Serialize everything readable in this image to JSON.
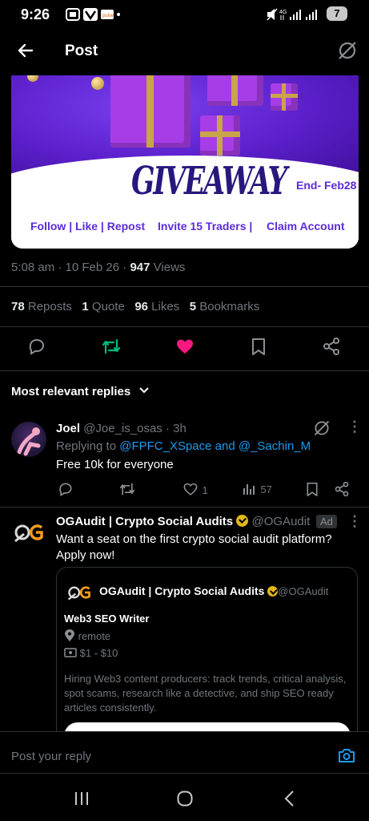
{
  "status_bar": {
    "time": "9:26",
    "network": "4G",
    "battery": "7"
  },
  "header": {
    "title": "Post"
  },
  "banner": {
    "headline": "GIVEAWAY",
    "end_text": "End- Feb28",
    "links": [
      "Follow | Like | Repost",
      "Invite 15 Traders |",
      "Claim Account"
    ],
    "colors": {
      "purple": "#5a1fc9",
      "gold": "#c9a54a",
      "text": "#27187e"
    }
  },
  "post_meta": {
    "time": "5:08 am",
    "date": "10 Feb 26",
    "views_count": "947",
    "views_label": "Views"
  },
  "post_stats": {
    "reposts": "78",
    "reposts_label": "Reposts",
    "quotes": "1",
    "quotes_label": "Quote",
    "likes": "96",
    "likes_label": "Likes",
    "bookmarks": "5",
    "bookmarks_label": "Bookmarks"
  },
  "actions": {
    "icons": [
      "reply-icon",
      "repost-icon",
      "like-icon",
      "bookmark-icon",
      "share-icon"
    ],
    "colors": {
      "repost": "#00ba7c",
      "like": "#f91880"
    }
  },
  "replies_section": {
    "title": "Most relevant replies"
  },
  "reply": {
    "name": "Joel",
    "handle": "@Joe_is_osas",
    "time": "3h",
    "replying_prefix": "Replying to",
    "replying_to": "@FPFC_XSpace and @_Sachin_M",
    "text": "Free 10k for everyone",
    "likes": "1",
    "views": "57"
  },
  "ad": {
    "name": "OGAudit | Crypto Social Audits",
    "handle": "@OGAudit",
    "badge": "Ad",
    "text": "Want a seat on the first crypto social audit platform? Apply now!",
    "card": {
      "name": "OGAudit | Crypto Social Audits",
      "handle": "@OGAudit",
      "job_title": "Web3 SEO Writer",
      "location": "remote",
      "pay": "$1 - $10",
      "description": "Hiring Web3 content producers: track trends, critical analysis, spot scams, research like a detective, and ship SEO ready articles consistently."
    }
  },
  "reply_bar": {
    "placeholder": "Post your reply"
  }
}
